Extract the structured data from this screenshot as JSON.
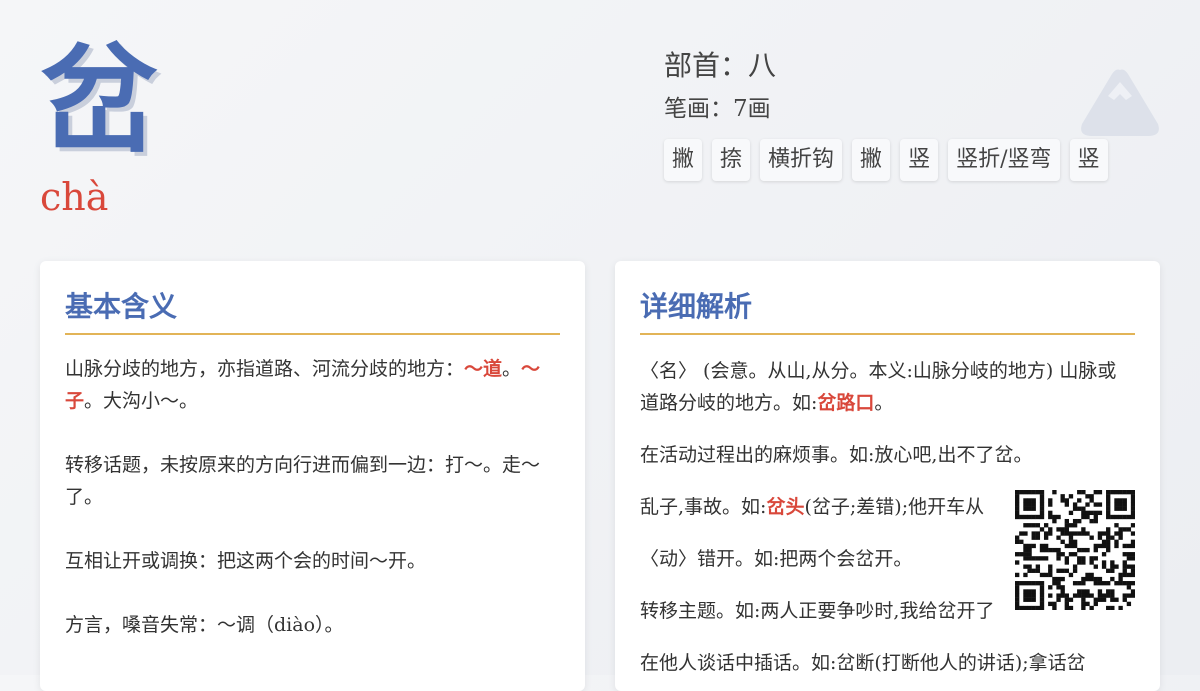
{
  "character": "岔",
  "pinyin": "chà",
  "radical": "部首：八",
  "strokes_count": "笔画：7画",
  "strokes": [
    "撇",
    "捺",
    "横折钩",
    "撇",
    "竖",
    "竖折/竖弯",
    "竖"
  ],
  "basic_meanings": {
    "title": "基本含义",
    "items": [
      {
        "parts": [
          {
            "text": "山脉分歧的地方，亦指道路、河流分歧的地方："
          },
          {
            "text": "～道",
            "hl": true
          },
          {
            "text": "。"
          },
          {
            "text": "～子",
            "hl": true
          },
          {
            "text": "。大沟小～。"
          }
        ]
      },
      {
        "parts": [
          {
            "text": "转移话题，未按原来的方向行进而偏到一边：打～。走～了。"
          }
        ]
      },
      {
        "parts": [
          {
            "text": "互相让开或调换：把这两个会的时间～开。"
          }
        ]
      },
      {
        "parts": [
          {
            "text": "方言，嗓音失常：～调（diào）。"
          }
        ]
      }
    ]
  },
  "detail": {
    "title": "详细解析",
    "items": [
      {
        "parts": [
          {
            "text": "〈名〉 (会意。从山,从分。本义:山脉分岐的地方) 山脉或道路分岐的地方。如:"
          },
          {
            "text": "岔路口",
            "hl": true
          },
          {
            "text": "。"
          }
        ]
      },
      {
        "parts": [
          {
            "text": "在活动过程出的麻烦事。如:放心吧,出不了岔。"
          }
        ]
      },
      {
        "parts": [
          {
            "text": "乱子,事故。如:"
          },
          {
            "text": "岔头",
            "hl": true
          },
          {
            "text": "(岔子;差错);他开车从"
          }
        ]
      },
      {
        "parts": [
          {
            "text": "〈动〉错开。如:把两个会岔开。"
          }
        ]
      },
      {
        "parts": [
          {
            "text": "转移主题。如:两人正要争吵时,我给岔开了"
          }
        ]
      },
      {
        "parts": [
          {
            "text": "在他人谈话中插话。如:岔断(打断他人的讲话);拿话岔"
          }
        ]
      }
    ]
  },
  "colors": {
    "accent": "#4a6cb3",
    "highlight": "#d9483b",
    "underline": "#e2b457"
  },
  "icons": {
    "logo": "mountain-icon",
    "qr": "qr-code"
  }
}
